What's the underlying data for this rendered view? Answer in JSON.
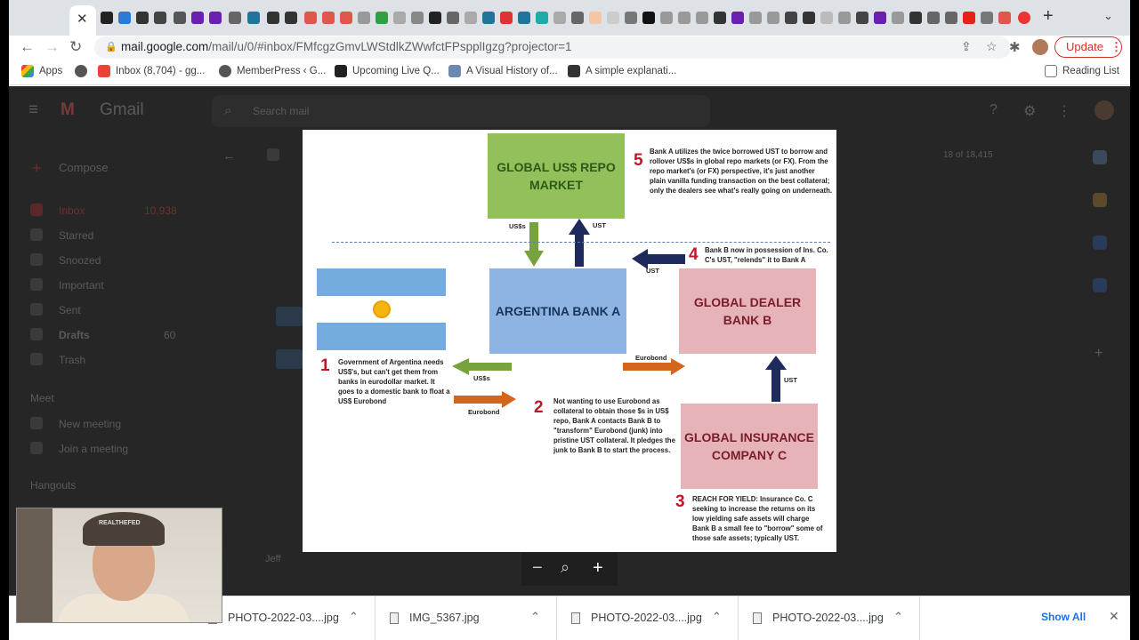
{
  "browser": {
    "url_host": "mail.google.com",
    "url_path": "/mail/u/0/#inbox/FMfcgzGmvLWStdlkZWwfctFPspplIgzg?projector=1",
    "update_label": "Update",
    "tab_close": "✕",
    "new_tab": "+",
    "tab_menu": "⌄"
  },
  "bookmarks": [
    {
      "label": "Apps"
    },
    {
      "label": ""
    },
    {
      "label": "Inbox (8,704) - gg..."
    },
    {
      "label": "MemberPress ‹ G..."
    },
    {
      "label": "Upcoming Live Q..."
    },
    {
      "label": "A Visual History of..."
    },
    {
      "label": "A simple explanati..."
    }
  ],
  "reading_list": "Reading List",
  "gmail": {
    "logo": "Gmail",
    "search_placeholder": "Search mail",
    "compose": "Compose",
    "nav": [
      {
        "label": "Inbox",
        "count": "10,938"
      },
      {
        "label": "Starred",
        "count": ""
      },
      {
        "label": "Snoozed",
        "count": ""
      },
      {
        "label": "Important",
        "count": ""
      },
      {
        "label": "Sent",
        "count": ""
      },
      {
        "label": "Drafts",
        "count": "60"
      },
      {
        "label": "Trash",
        "count": ""
      }
    ],
    "meet_header": "Meet",
    "meet_items": [
      "New meeting",
      "Join a meeting"
    ],
    "hangouts_header": "Hangouts",
    "sender_initial": "Jeff",
    "timestamp": "18 of 18,415"
  },
  "slide": {
    "repo_market": "GLOBAL US$ REPO MARKET",
    "argentina_bank": "ARGENTINA BANK A",
    "dealer_bank": "GLOBAL DEALER BANK B",
    "insurance": "GLOBAL INSURANCE COMPANY C",
    "step1_num": "1",
    "step1_text": "Government of Argentina needs US$'s, but can't get them from banks in eurodollar market. It goes to a domestic bank to float a US$ Eurobond",
    "step2_num": "2",
    "step2_text": "Not wanting to use Eurobond as collateral to obtain those $s in US$ repo, Bank A contacts Bank B to \"transform\" Eurobond (junk) into pristine UST collateral. It pledges the junk to Bank B to start the process.",
    "step3_num": "3",
    "step3_text": "REACH FOR YIELD: Insurance Co. C seeking to increase the returns on its low yielding safe assets will charge Bank B a small fee to \"borrow\" some of those safe assets; typically UST.",
    "step4_num": "4",
    "step4_text": "Bank B now in possession of Ins. Co. C's UST, \"relends\" it to Bank A",
    "step5_num": "5",
    "step5_text": "Bank A utilizes the twice borrowed UST to borrow and rollover US$s in global repo markets (or FX). From the repo market's (or FX) perspective, it's just another plain vanilla funding transaction on the best collateral; only the dealers see what's really going on underneath.",
    "label_usd_down": "US$s",
    "label_ust_up": "UST",
    "label_ust_left": "UST",
    "label_usd_left": "US$s",
    "label_eurobond_right": "Eurobond",
    "label_eurobond_bottom": "Eurobond",
    "label_ust_vertical": "UST",
    "colors": {
      "repo": "#93c05a",
      "argentina": "#8eb4e3",
      "dealer": "#e6b3b9",
      "arrow_green": "#77a33c",
      "arrow_navy": "#1f2a5c",
      "arrow_orange": "#d4661c"
    }
  },
  "zoom": {
    "minus": "−",
    "zoom_icon": "⌕",
    "plus": "+"
  },
  "downloads": [
    {
      "name": "PHOTO-2022-03....jpg"
    },
    {
      "name": "IMG_5367.jpg"
    },
    {
      "name": "PHOTO-2022-03....jpg"
    },
    {
      "name": "PHOTO-2022-03....jpg"
    }
  ],
  "show_all": "Show All",
  "webcam_cap_text": "REALTHEFED"
}
